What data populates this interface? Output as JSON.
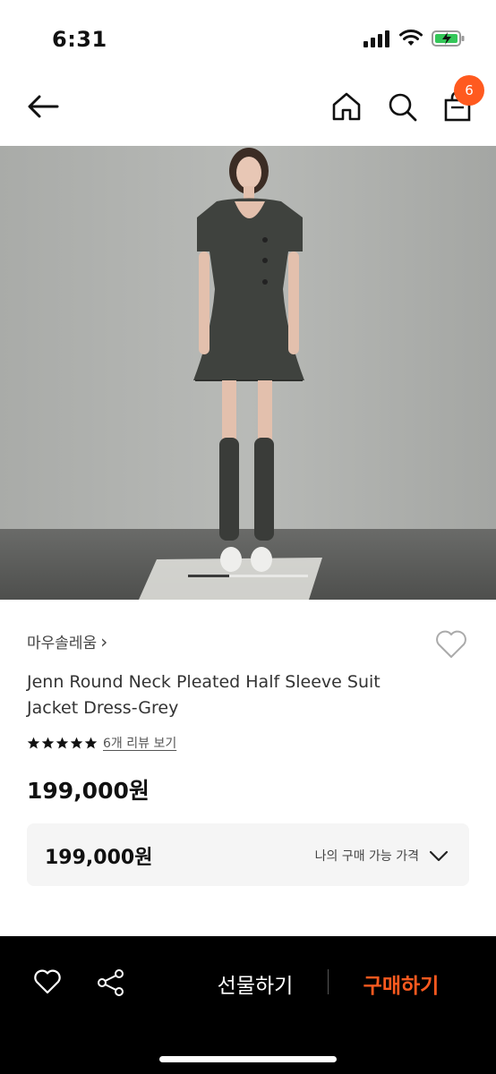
{
  "status_bar": {
    "time": "6:31"
  },
  "nav": {
    "cart_count": "6"
  },
  "product": {
    "brand": "마우솔레움",
    "brand_chevron": "›",
    "title": "Jenn Round Neck Pleated Half Sleeve Suit Jacket Dress-Grey",
    "rating_stars": 5,
    "review_link": "6개 리뷰 보기",
    "price": "199,000원"
  },
  "my_price": {
    "value": "199,000원",
    "label": "나의 구매 가능 가격"
  },
  "bottom_bar": {
    "gift_label": "선물하기",
    "buy_label": "구매하기"
  },
  "colors": {
    "accent": "#ff5a1f",
    "bottom_bar": "#000000"
  },
  "icons": [
    "back-arrow-icon",
    "home-icon",
    "search-icon",
    "shopping-bag-icon",
    "heart-icon",
    "share-icon",
    "chevron-down-icon",
    "star-icon"
  ]
}
